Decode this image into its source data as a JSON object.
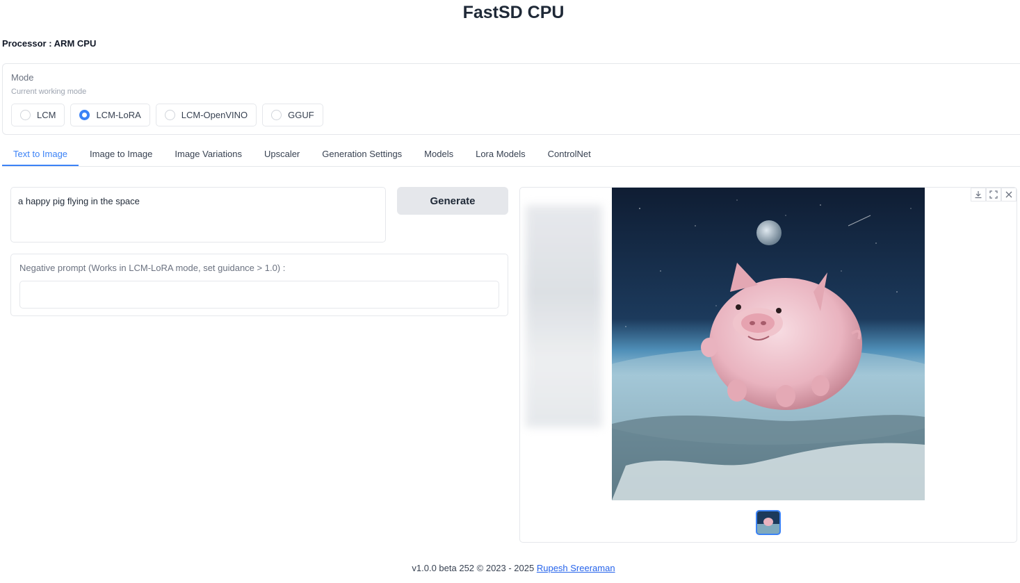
{
  "app": {
    "title": "FastSD CPU",
    "processor": "Processor : ARM CPU"
  },
  "mode": {
    "label": "Mode",
    "info": "Current working mode",
    "options": [
      "LCM",
      "LCM-LoRA",
      "LCM-OpenVINO",
      "GGUF"
    ],
    "selected": "LCM-LoRA"
  },
  "tabs": [
    "Text to Image",
    "Image to Image",
    "Image Variations",
    "Upscaler",
    "Generation Settings",
    "Models",
    "Lora Models",
    "ControlNet"
  ],
  "active_tab": "Text to Image",
  "prompt": {
    "value": "a happy pig flying in the space"
  },
  "generate": {
    "label": "Generate"
  },
  "negative": {
    "label": "Negative prompt (Works in LCM-LoRA mode, set guidance > 1.0) :",
    "value": ""
  },
  "gallery": {
    "icons": [
      "download-icon",
      "fullscreen-icon",
      "close-icon"
    ]
  },
  "footer": {
    "text": "v1.0.0 beta 252 © 2023 - 2025 ",
    "link": "Rupesh Sreeraman"
  },
  "colors": {
    "accent": "#3b82f6",
    "border": "#e5e7eb",
    "button_bg": "#e5e7eb"
  }
}
